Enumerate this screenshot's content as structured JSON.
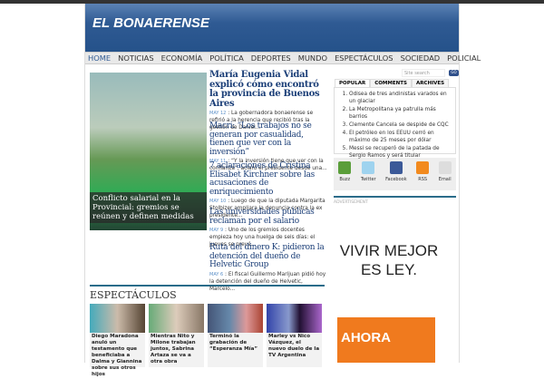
{
  "site_title": "EL BONAERENSE",
  "nav": [
    "HOME",
    "NOTICIAS",
    "ECONOMÍA",
    "POLÍTICA",
    "DEPORTES",
    "MUNDO",
    "ESPECTÁCULOS",
    "SOCIEDAD",
    "POLICIAL"
  ],
  "featured_caption": "Conflicto salarial en la Provincial: gremios se reúnen y definen medidas",
  "stories": [
    {
      "title": "María Eugenia Vidal explicó cómo encontró la provincia de Buenos Aires",
      "date": "MAY 12",
      "excerpt": "La gobernadora bonaerense se refirió a la herencia que recibió tras la gestión de Daniel..."
    },
    {
      "title": "Macri: “Los trabajos no se generan por casualidad, tienen que ver con la inversión”",
      "date": "MAY 11",
      "excerpt": "“Y la inversión tiene que ver con la confianza”, aclaró el presidente desde una..."
    },
    {
      "title": "7 aclaraciones de Cristina Elisabet Kirchner sobre las acusaciones de enriquecimiento",
      "date": "MAY 10",
      "excerpt": "Luego de que la diputada Margarita Stolbizer ampliara la denuncia contra la ex presidente..."
    },
    {
      "title": "Las universidades públicas reclaman por el salario",
      "date": "MAY 9",
      "excerpt": "Uno de los gremios docentes empieza hoy una huelga de seis días: el jueves se prevé..."
    },
    {
      "title": "Ruta del dinero K: pidieron la detención del dueño de Helvetic Group",
      "date": "MAY 6",
      "excerpt": "El fiscal Guillermo Marijuan pidió hoy la detención del dueño de Helvetic, Marcelo..."
    }
  ],
  "search": {
    "placeholder": "Site search",
    "button": "GO"
  },
  "tabs": [
    "POPULAR",
    "COMMENTS",
    "ARCHIVES"
  ],
  "popular": [
    "Odisea de tres andinistas varados en un glaciar",
    "La Metropolitana ya patrulla más barrios",
    "Clemente Cancela se despide de CQC",
    "El petróleo en los EEUU cerró en máximo de 25 meses por dólar",
    "Messi se recuperó de la patada de Sergio Ramos y será titular"
  ],
  "social": [
    {
      "label": "Buzz",
      "color": "#5a9e3a"
    },
    {
      "label": "Twitter",
      "color": "#9fd3ef"
    },
    {
      "label": "Facebook",
      "color": "#3b5998"
    },
    {
      "label": "RSS",
      "color": "#f28a1e"
    },
    {
      "label": "Email",
      "color": "#ddd"
    }
  ],
  "ad_label": "ADVERTISEMENT",
  "ad_text": "VIVIR MEJOR ES LEY.",
  "ad2_text": "AHORA",
  "section_title": "ESPECTÁCULOS",
  "cards": [
    "Diego Maradona anuló un testamento que beneficiaba a Dalma y Giannina sobre sus otros hijos",
    "Mientras Nito y Milone trabajan juntos, Sabrina Artaza se va a otra obra",
    "Terminó la grabación de “Esperanza Mía”",
    "Marley vs Nico Vázquez, el nuevo duelo de la TV Argentina"
  ]
}
